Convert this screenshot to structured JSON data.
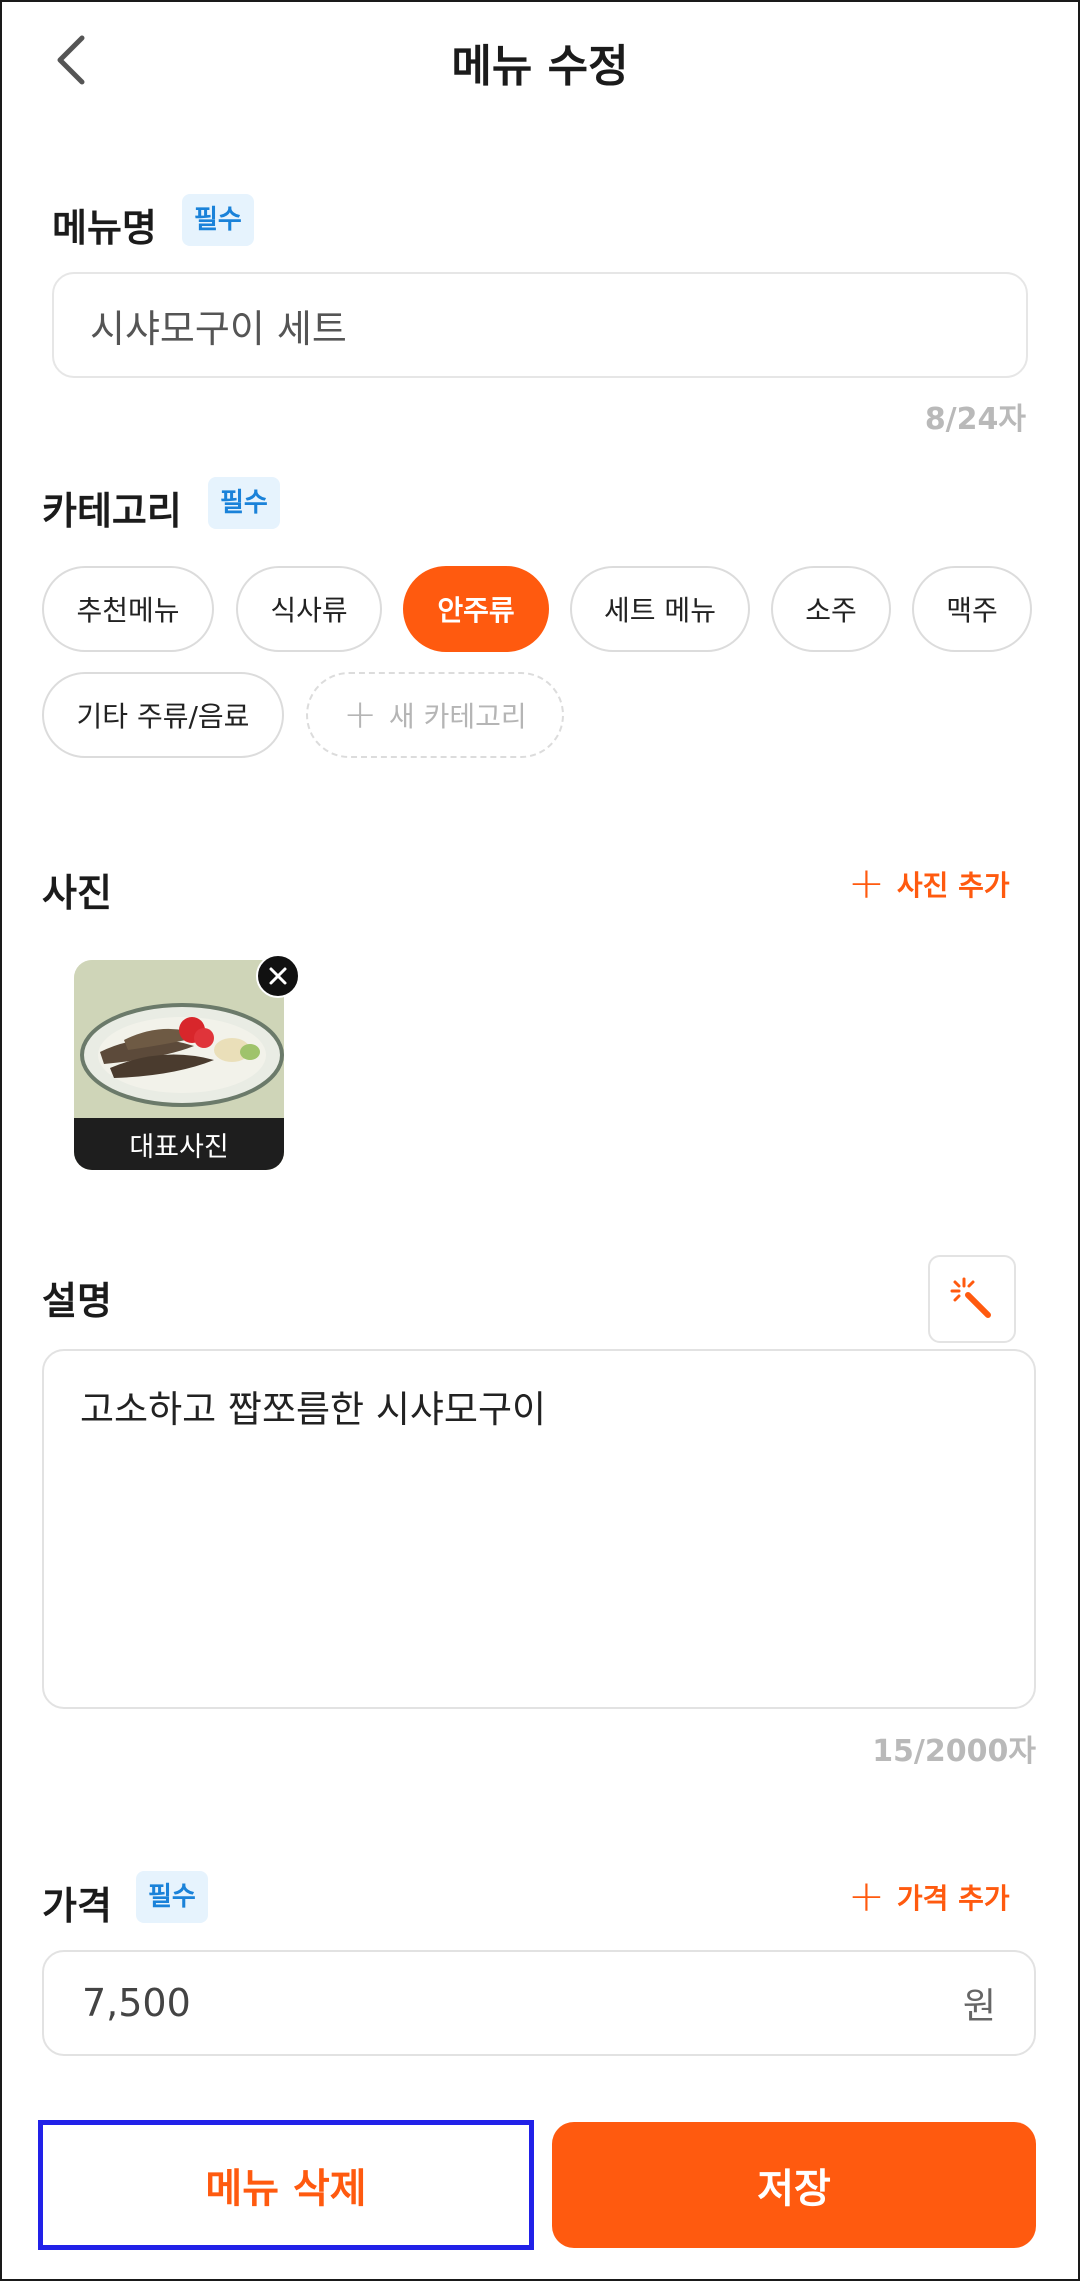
{
  "header": {
    "title": "메뉴 수정",
    "back_icon": "chevron-left-icon"
  },
  "menu_name": {
    "label": "메뉴명",
    "required_badge": "필수",
    "value": "시샤모구이 세트",
    "counter": "8/24자"
  },
  "category": {
    "label": "카테고리",
    "required_badge": "필수",
    "chips": [
      {
        "label": "추천메뉴",
        "selected": false
      },
      {
        "label": "식사류",
        "selected": false
      },
      {
        "label": "안주류",
        "selected": true
      },
      {
        "label": "세트 메뉴",
        "selected": false
      },
      {
        "label": "소주",
        "selected": false
      },
      {
        "label": "맥주",
        "selected": false
      },
      {
        "label": "기타 주류/음료",
        "selected": false
      }
    ],
    "add_label": "새 카테고리"
  },
  "photo": {
    "label": "사진",
    "add_label": "사진 추가",
    "main_photo_label": "대표사진"
  },
  "description": {
    "label": "설명",
    "value": "고소하고 짭쪼름한 시샤모구이",
    "counter": "15/2000자",
    "ai_icon": "magic-wand-icon"
  },
  "price": {
    "label": "가격",
    "required_badge": "필수",
    "add_label": "가격 추가",
    "value": "7,500",
    "unit": "원"
  },
  "actions": {
    "delete_label": "메뉴 삭제",
    "save_label": "저장"
  },
  "colors": {
    "accent": "#ff5a0f",
    "badge_bg": "#e6f3fd",
    "badge_text": "#1a82d9",
    "highlight_border": "#2121e8"
  }
}
